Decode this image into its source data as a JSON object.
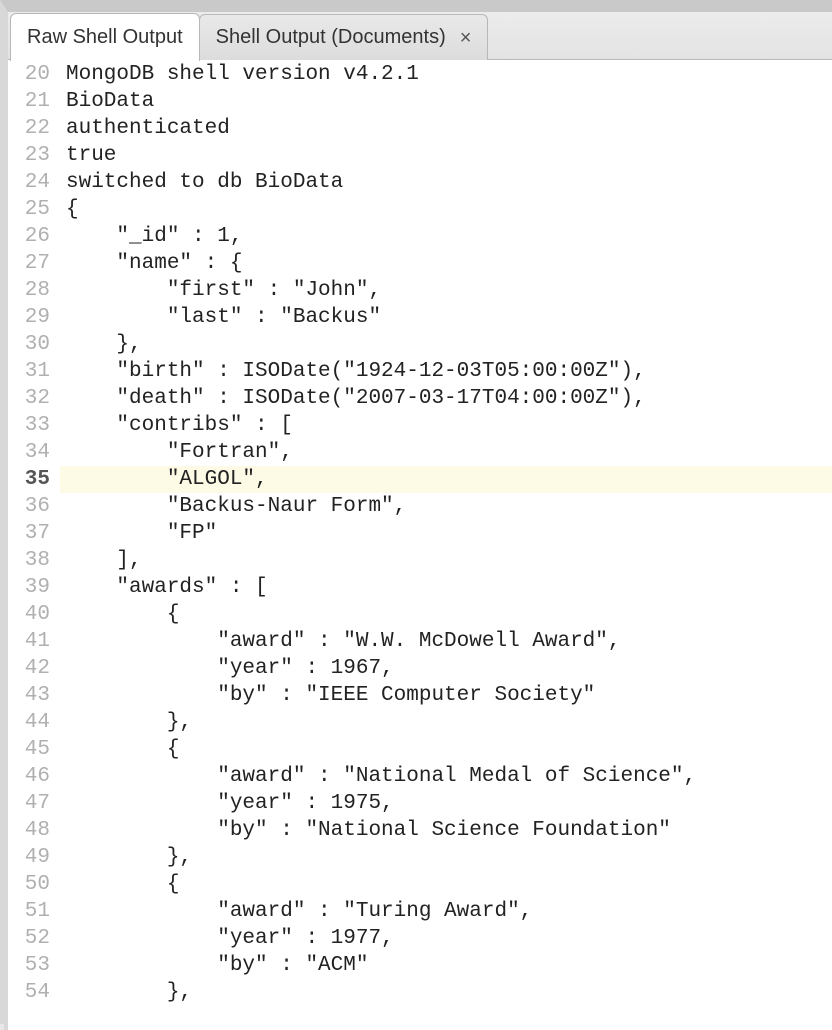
{
  "tabs": [
    {
      "label": "Raw Shell Output",
      "active": true,
      "closeable": false
    },
    {
      "label": "Shell Output (Documents)",
      "active": false,
      "closeable": true
    }
  ],
  "startLine": 20,
  "highlightLine": 35,
  "lines": [
    "MongoDB shell version v4.2.1",
    "BioData",
    "authenticated",
    "true",
    "switched to db BioData",
    "{",
    "    \"_id\" : 1,",
    "    \"name\" : {",
    "        \"first\" : \"John\",",
    "        \"last\" : \"Backus\"",
    "    },",
    "    \"birth\" : ISODate(\"1924-12-03T05:00:00Z\"),",
    "    \"death\" : ISODate(\"2007-03-17T04:00:00Z\"),",
    "    \"contribs\" : [",
    "        \"Fortran\",",
    "        \"ALGOL\",",
    "        \"Backus-Naur Form\",",
    "        \"FP\"",
    "    ],",
    "    \"awards\" : [",
    "        {",
    "            \"award\" : \"W.W. McDowell Award\",",
    "            \"year\" : 1967,",
    "            \"by\" : \"IEEE Computer Society\"",
    "        },",
    "        {",
    "            \"award\" : \"National Medal of Science\",",
    "            \"year\" : 1975,",
    "            \"by\" : \"National Science Foundation\"",
    "        },",
    "        {",
    "            \"award\" : \"Turing Award\",",
    "            \"year\" : 1977,",
    "            \"by\" : \"ACM\"",
    "        },"
  ]
}
